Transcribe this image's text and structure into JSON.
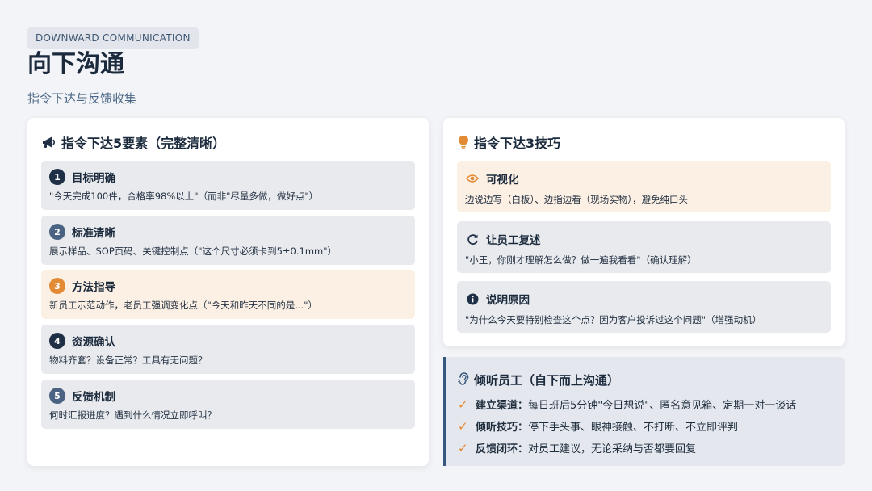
{
  "header": {
    "tag": "DOWNWARD COMMUNICATION",
    "title": "向下沟通",
    "subtitle": "指令下达与反馈收集"
  },
  "left": {
    "title": "指令下达5要素（完整清晰）",
    "icon": "megaphone-icon",
    "items": [
      {
        "num": "1",
        "title": "目标明确",
        "desc": "\"今天完成100件，合格率98%以上\"（而非\"尽量多做，做好点\"）"
      },
      {
        "num": "2",
        "title": "标准清晰",
        "desc": "展示样品、SOP页码、关键控制点（\"这个尺寸必须卡到5±0.1mm\"）"
      },
      {
        "num": "3",
        "title": "方法指导",
        "desc": "新员工示范动作，老员工强调变化点（\"今天和昨天不同的是...\"）"
      },
      {
        "num": "4",
        "title": "资源确认",
        "desc": "物料齐套？设备正常？工具有无问题？"
      },
      {
        "num": "5",
        "title": "反馈机制",
        "desc": "何时汇报进度？遇到什么情况立即呼叫？"
      }
    ]
  },
  "right": {
    "title": "指令下达3技巧",
    "icon": "lightbulb-icon",
    "items": [
      {
        "icon": "eye-icon",
        "title": "可视化",
        "desc": "边说边写（白板）、边指边看（现场实物），避免纯口头"
      },
      {
        "icon": "refresh-icon",
        "title": "让员工复述",
        "desc": "\"小王，你刚才理解怎么做？做一遍我看看\"（确认理解）"
      },
      {
        "icon": "info-icon",
        "title": "说明原因",
        "desc": "\"为什么今天要特别检查这个点？因为客户投诉过这个问题\"（增强动机）"
      }
    ]
  },
  "listen": {
    "title": "倾听员工（自下而上沟通）",
    "icon": "ear-icon",
    "rows": [
      {
        "label": "建立渠道：",
        "text": "每日班后5分钟\"今日想说\"、匿名意见箱、定期一对一谈话"
      },
      {
        "label": "倾听技巧：",
        "text": "停下手头事、眼神接触、不打断、不立即评判"
      },
      {
        "label": "反馈闭环：",
        "text": "对员工建议，无论采纳与否都要回复"
      }
    ]
  },
  "colors": {
    "accent": "#e28a34",
    "navy": "#1f2f46",
    "highlight_bg": "#fcf0e4",
    "item_bg": "#e8eaee"
  }
}
